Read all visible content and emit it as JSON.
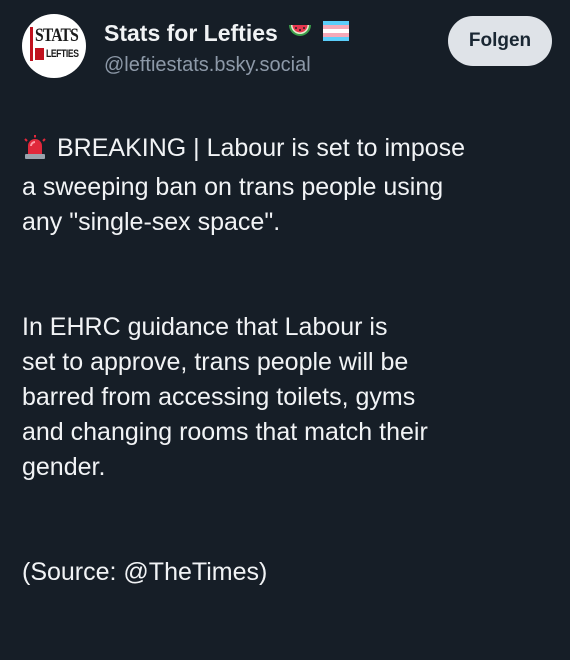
{
  "post": {
    "display_name": "Stats for Lefties",
    "name_emojis": [
      "watermelon-icon",
      "trans-flag-icon"
    ],
    "handle": "@leftiestats.bsky.social",
    "follow_label": "Folgen",
    "avatar_logo": {
      "line1": "STATS",
      "line2": "LEFTIES"
    },
    "paragraphs": {
      "p1": "BREAKING | Labour is set to impose\na sweeping ban on trans people using\nany \"single-sex space\".",
      "p2": "In EHRC guidance that Labour is\nset to approve, trans people will be\nbarred from accessing toilets, gyms\nand changing rooms that match their\ngender.",
      "p3": "(Source: @TheTimes)"
    },
    "p1_icon": "siren-icon"
  },
  "colors": {
    "background": "#161e27",
    "text": "#f1f3f5",
    "handle": "#8d99a8",
    "button_bg": "#dfe3e8",
    "button_text": "#1a2733"
  }
}
